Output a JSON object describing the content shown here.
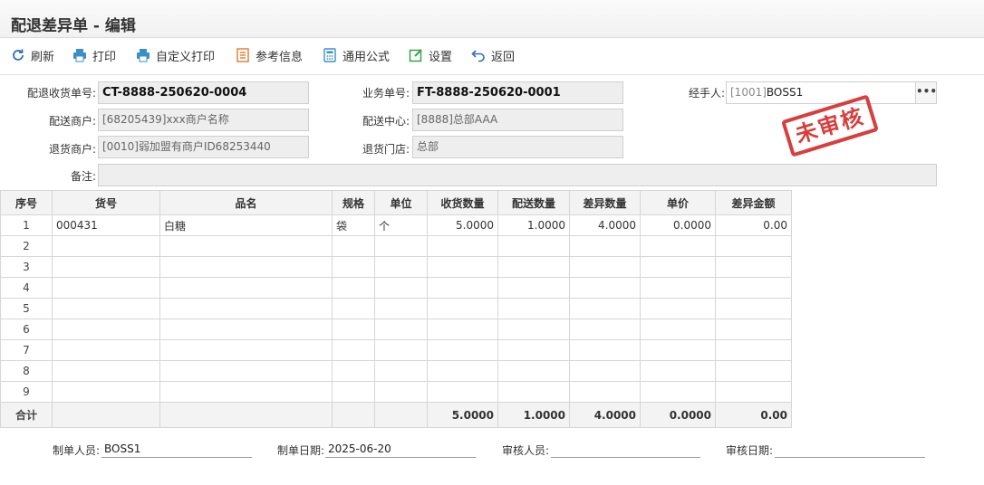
{
  "window": {
    "title": "配退差异单 - 编辑"
  },
  "toolbar": {
    "refresh": "刷新",
    "print": "打印",
    "custom_print": "自定义打印",
    "reference_info": "参考信息",
    "common_formula": "通用公式",
    "settings": "设置",
    "back": "返回"
  },
  "form": {
    "return_order_no_label": "配退收货单号:",
    "return_order_no": "CT-8888-250620-0004",
    "business_no_label": "业务单号:",
    "business_no": "FT-8888-250620-0001",
    "handler_label": "经手人:",
    "handler_code": "[1001]",
    "handler_name": "BOSS1",
    "handler_more": "•••",
    "delivery_merchant_label": "配送商户:",
    "delivery_merchant": "[68205439]xxx商户名称",
    "delivery_center_label": "配送中心:",
    "delivery_center": "[8888]总部AAA",
    "return_merchant_label": "退货商户:",
    "return_merchant": "[0010]弱加盟有商户ID68253440",
    "return_store_label": "退货门店:",
    "return_store": "总部",
    "remark_label": "备注:",
    "remark": ""
  },
  "stamp": {
    "text": "未审核",
    "color": "#d42a2a"
  },
  "grid": {
    "columns": [
      "序号",
      "货号",
      "品名",
      "规格",
      "单位",
      "收货数量",
      "配送数量",
      "差异数量",
      "单价",
      "差异金额"
    ],
    "rows": [
      [
        "1",
        "000431",
        "白糖",
        "袋",
        "个",
        "5.0000",
        "1.0000",
        "4.0000",
        "0.0000",
        "0.00"
      ],
      [
        "2",
        "",
        "",
        "",
        "",
        "",
        "",
        "",
        "",
        ""
      ],
      [
        "3",
        "",
        "",
        "",
        "",
        "",
        "",
        "",
        "",
        ""
      ],
      [
        "4",
        "",
        "",
        "",
        "",
        "",
        "",
        "",
        "",
        ""
      ],
      [
        "5",
        "",
        "",
        "",
        "",
        "",
        "",
        "",
        "",
        ""
      ],
      [
        "6",
        "",
        "",
        "",
        "",
        "",
        "",
        "",
        "",
        ""
      ],
      [
        "7",
        "",
        "",
        "",
        "",
        "",
        "",
        "",
        "",
        ""
      ],
      [
        "8",
        "",
        "",
        "",
        "",
        "",
        "",
        "",
        "",
        ""
      ],
      [
        "9",
        "",
        "",
        "",
        "",
        "",
        "",
        "",
        "",
        ""
      ]
    ],
    "total": [
      "合计",
      "",
      "",
      "",
      "",
      "5.0000",
      "1.0000",
      "4.0000",
      "0.0000",
      "0.00"
    ]
  },
  "footer": {
    "maker_label": "制单人员:",
    "maker": "BOSS1",
    "make_date_label": "制单日期:",
    "make_date": "2025-06-20",
    "auditor_label": "审核人员:",
    "auditor": "",
    "audit_date_label": "审核日期:",
    "audit_date": ""
  },
  "icons": {
    "refresh": "refresh-icon",
    "print": "printer-icon",
    "custom_print": "printer-icon",
    "reference_info": "list-icon",
    "common_formula": "calculator-icon",
    "settings": "edit-icon",
    "back": "undo-icon"
  }
}
